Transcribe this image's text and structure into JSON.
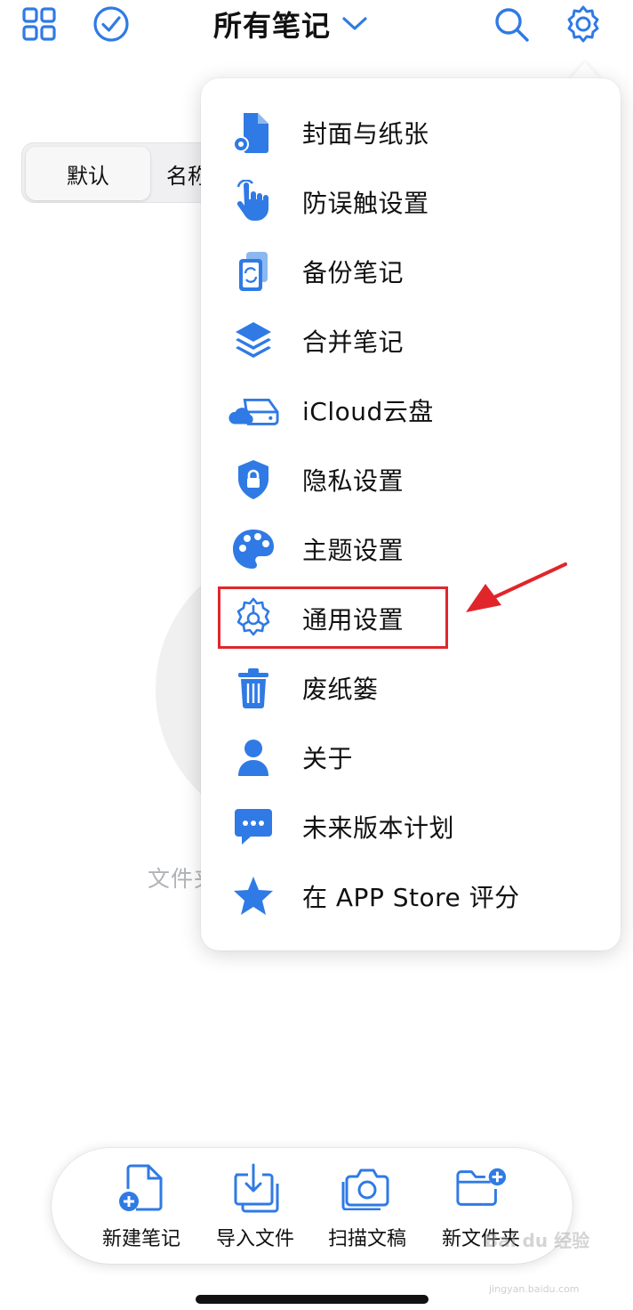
{
  "header": {
    "title": "所有笔记",
    "icons": [
      "grid-icon",
      "check-circle-icon",
      "chevron-down-icon",
      "search-icon",
      "gear-icon"
    ]
  },
  "sort_segment": {
    "active": "默认",
    "second": "名称"
  },
  "empty_state": {
    "text": "文件夹"
  },
  "menu": {
    "items": [
      {
        "label": "封面与纸张",
        "icon": "document-settings-icon"
      },
      {
        "label": "防误触设置",
        "icon": "hand-touch-icon"
      },
      {
        "label": "备份笔记",
        "icon": "backup-icon"
      },
      {
        "label": "合并笔记",
        "icon": "layers-icon"
      },
      {
        "label": "iCloud云盘",
        "icon": "cloud-drive-icon"
      },
      {
        "label": "隐私设置",
        "icon": "shield-lock-icon"
      },
      {
        "label": "主题设置",
        "icon": "palette-icon"
      },
      {
        "label": "通用设置",
        "icon": "gear-icon"
      },
      {
        "label": "废纸篓",
        "icon": "trash-icon"
      },
      {
        "label": "关于",
        "icon": "person-icon"
      },
      {
        "label": "未来版本计划",
        "icon": "chat-bubble-icon"
      },
      {
        "label": "在 APP Store 评分",
        "icon": "star-icon"
      }
    ],
    "highlighted": "通用设置"
  },
  "toolbar": {
    "items": [
      {
        "label": "新建笔记",
        "icon": "new-note-icon"
      },
      {
        "label": "导入文件",
        "icon": "import-icon"
      },
      {
        "label": "扫描文稿",
        "icon": "camera-icon"
      },
      {
        "label": "新文件夹",
        "icon": "new-folder-icon"
      }
    ]
  },
  "watermark": {
    "brand": "Bai du 经验",
    "url": "jingyan.baidu.com"
  },
  "colors": {
    "accent": "#2f7ae5",
    "highlight": "#e0262b"
  }
}
